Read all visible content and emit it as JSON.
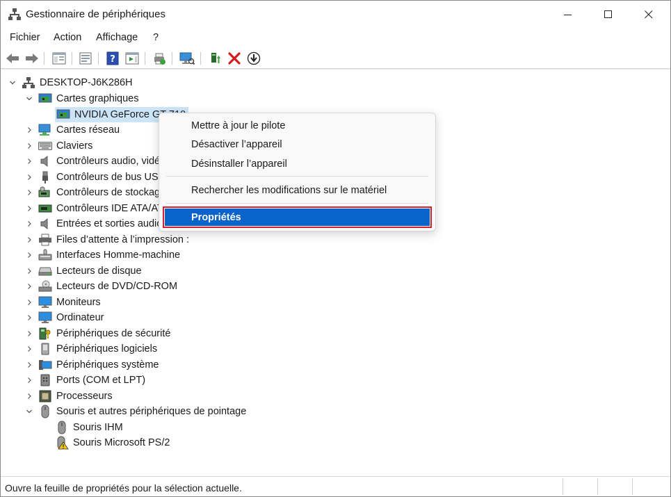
{
  "window": {
    "title": "Gestionnaire de périphériques"
  },
  "menubar": {
    "items": [
      "Fichier",
      "Action",
      "Affichage",
      "?"
    ]
  },
  "tree": {
    "root": "DESKTOP-J6K286H",
    "rows": [
      {
        "label": "Cartes graphiques",
        "expanded": true,
        "icon": "display-adapter-icon"
      },
      {
        "label": "NVIDIA GeForce GT 710",
        "child": true,
        "selected": true,
        "icon": "display-adapter-icon"
      },
      {
        "label": "Cartes réseau",
        "icon": "network-adapter-icon"
      },
      {
        "label": "Claviers",
        "icon": "keyboard-icon"
      },
      {
        "label": "Contrôleurs audio, vidéo et jeu",
        "icon": "speaker-icon"
      },
      {
        "label": "Contrôleurs de bus USB",
        "icon": "usb-icon"
      },
      {
        "label": "Contrôleurs de stockage",
        "icon": "storage-controller-icon"
      },
      {
        "label": "Contrôleurs IDE ATA/ATAPI",
        "icon": "ide-controller-icon"
      },
      {
        "label": "Entrées et sorties audio",
        "icon": "speaker-icon"
      },
      {
        "label": "Files d’attente à l’impression :",
        "icon": "printer-icon"
      },
      {
        "label": "Interfaces Homme-machine",
        "icon": "hid-icon"
      },
      {
        "label": "Lecteurs de disque",
        "icon": "disk-drive-icon"
      },
      {
        "label": "Lecteurs de DVD/CD-ROM",
        "icon": "dvd-drive-icon"
      },
      {
        "label": "Moniteurs",
        "icon": "monitor-icon"
      },
      {
        "label": "Ordinateur",
        "icon": "computer-icon"
      },
      {
        "label": "Périphériques de sécurité",
        "icon": "security-device-icon"
      },
      {
        "label": "Périphériques logiciels",
        "icon": "software-device-icon"
      },
      {
        "label": "Périphériques système",
        "icon": "system-device-icon"
      },
      {
        "label": "Ports (COM et LPT)",
        "icon": "port-icon"
      },
      {
        "label": "Processeurs",
        "icon": "processor-icon"
      },
      {
        "label": "Souris et autres périphériques de pointage",
        "expanded": true,
        "icon": "mouse-icon"
      },
      {
        "label": "Souris IHM",
        "child": true,
        "icon": "mouse-icon"
      },
      {
        "label": "Souris Microsoft PS/2",
        "child": true,
        "icon": "mouse-warning-icon"
      }
    ]
  },
  "context_menu": {
    "update_driver": "Mettre à jour le pilote",
    "disable_device": "Désactiver l’appareil",
    "uninstall_device": "Désinstaller l’appareil",
    "scan_hardware": "Rechercher les modifications sur le matériel",
    "properties": "Propriétés"
  },
  "statusbar": {
    "text": "Ouvre la feuille de propriétés pour la sélection actuelle."
  },
  "colors": {
    "selection": "#cce4f7",
    "menu_active": "#0a63c9",
    "highlight_border": "#d32030"
  }
}
